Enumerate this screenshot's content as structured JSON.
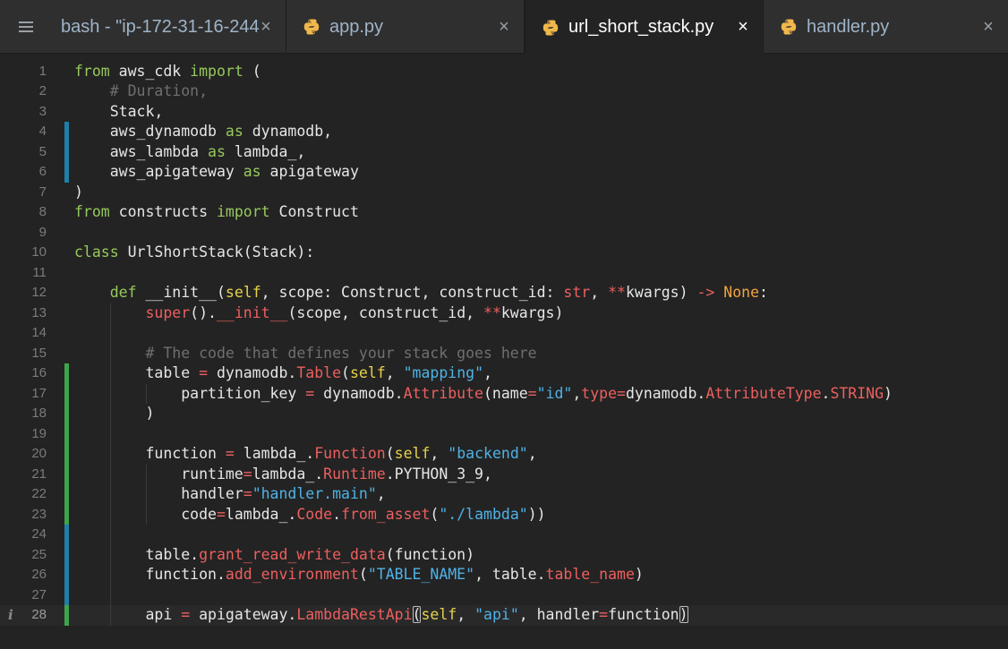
{
  "tabs": [
    {
      "label": "bash - \"ip-172-31-16-244.",
      "icon": "none",
      "close": "×"
    },
    {
      "label": "app.py",
      "icon": "python-icon",
      "close": "×"
    },
    {
      "label": "url_short_stack.py",
      "icon": "python-icon",
      "close": "×",
      "active": true
    },
    {
      "label": "handler.py",
      "icon": "python-icon",
      "close": "×"
    }
  ],
  "menu_icon": "menu-icon",
  "colors": {
    "keyword": "#97c95c",
    "comment": "#6f6f6f",
    "string": "#4fb2e6",
    "function": "#ee5f5f",
    "constant": "#f2a340",
    "self": "#e8d24b",
    "git_added": "#3fa34d",
    "git_modified": "#1f7fa8"
  },
  "editor": {
    "current_line": 28,
    "info_marker": "i",
    "lines": [
      {
        "n": "1",
        "tokens": [
          [
            "k",
            "from"
          ],
          [
            "t",
            " aws_cdk "
          ],
          [
            "k",
            "import"
          ],
          [
            "t",
            " ("
          ]
        ]
      },
      {
        "n": "2",
        "tokens": [
          [
            "t",
            "    "
          ],
          [
            "c",
            "# Duration,"
          ]
        ]
      },
      {
        "n": "3",
        "tokens": [
          [
            "t",
            "    Stack,"
          ]
        ]
      },
      {
        "n": "4",
        "tokens": [
          [
            "t",
            "    aws_dynamodb "
          ],
          [
            "k",
            "as"
          ],
          [
            "t",
            " dynamodb,"
          ]
        ]
      },
      {
        "n": "5",
        "tokens": [
          [
            "t",
            "    aws_lambda "
          ],
          [
            "k",
            "as"
          ],
          [
            "t",
            " lambda_,"
          ]
        ]
      },
      {
        "n": "6",
        "tokens": [
          [
            "t",
            "    aws_apigateway "
          ],
          [
            "k",
            "as"
          ],
          [
            "t",
            " apigateway"
          ]
        ]
      },
      {
        "n": "7",
        "tokens": [
          [
            "t",
            ")"
          ]
        ]
      },
      {
        "n": "8",
        "tokens": [
          [
            "k",
            "from"
          ],
          [
            "t",
            " constructs "
          ],
          [
            "k",
            "import"
          ],
          [
            "t",
            " Construct"
          ]
        ]
      },
      {
        "n": "9",
        "tokens": []
      },
      {
        "n": "10",
        "tokens": [
          [
            "k",
            "class"
          ],
          [
            "t",
            " UrlShortStack(Stack):"
          ]
        ]
      },
      {
        "n": "11",
        "tokens": []
      },
      {
        "n": "12",
        "tokens": [
          [
            "t",
            "    "
          ],
          [
            "k",
            "def"
          ],
          [
            "t",
            " __init__("
          ],
          [
            "y",
            "self"
          ],
          [
            "t",
            ", scope: Construct, construct_id: "
          ],
          [
            "f",
            "str"
          ],
          [
            "t",
            ", "
          ],
          [
            "f",
            "**"
          ],
          [
            "t",
            "kwargs) "
          ],
          [
            "f",
            "->"
          ],
          [
            "t",
            " "
          ],
          [
            "o",
            "None"
          ],
          [
            "t",
            ":"
          ]
        ]
      },
      {
        "n": "13",
        "tokens": [
          [
            "t",
            "        "
          ],
          [
            "f",
            "super"
          ],
          [
            "t",
            "()."
          ],
          [
            "f",
            "__init__"
          ],
          [
            "t",
            "(scope, construct_id, "
          ],
          [
            "f",
            "**"
          ],
          [
            "t",
            "kwargs)"
          ]
        ]
      },
      {
        "n": "14",
        "tokens": []
      },
      {
        "n": "15",
        "tokens": [
          [
            "t",
            "        "
          ],
          [
            "c",
            "# The code that defines your stack goes here"
          ]
        ]
      },
      {
        "n": "16",
        "tokens": [
          [
            "t",
            "        table "
          ],
          [
            "f",
            "="
          ],
          [
            "t",
            " dynamodb."
          ],
          [
            "f",
            "Table"
          ],
          [
            "t",
            "("
          ],
          [
            "y",
            "self"
          ],
          [
            "t",
            ", "
          ],
          [
            "s",
            "\"mapping\""
          ],
          [
            "t",
            ","
          ]
        ]
      },
      {
        "n": "17",
        "tokens": [
          [
            "t",
            "            partition_key "
          ],
          [
            "f",
            "="
          ],
          [
            "t",
            " dynamodb."
          ],
          [
            "f",
            "Attribute"
          ],
          [
            "t",
            "(name"
          ],
          [
            "f",
            "="
          ],
          [
            "s",
            "\"id\""
          ],
          [
            "t",
            ","
          ],
          [
            "f",
            "type"
          ],
          [
            "f",
            "="
          ],
          [
            "t",
            "dynamodb."
          ],
          [
            "f",
            "AttributeType"
          ],
          [
            "t",
            "."
          ],
          [
            "f",
            "STRING"
          ],
          [
            "t",
            ")"
          ]
        ]
      },
      {
        "n": "18",
        "tokens": [
          [
            "t",
            "        )"
          ]
        ]
      },
      {
        "n": "19",
        "tokens": []
      },
      {
        "n": "20",
        "tokens": [
          [
            "t",
            "        function "
          ],
          [
            "f",
            "="
          ],
          [
            "t",
            " lambda_."
          ],
          [
            "f",
            "Function"
          ],
          [
            "t",
            "("
          ],
          [
            "y",
            "self"
          ],
          [
            "t",
            ", "
          ],
          [
            "s",
            "\"backend\""
          ],
          [
            "t",
            ","
          ]
        ]
      },
      {
        "n": "21",
        "tokens": [
          [
            "t",
            "            runtime"
          ],
          [
            "f",
            "="
          ],
          [
            "t",
            "lambda_."
          ],
          [
            "f",
            "Runtime"
          ],
          [
            "t",
            ".PYTHON_3_9,"
          ]
        ]
      },
      {
        "n": "22",
        "tokens": [
          [
            "t",
            "            handler"
          ],
          [
            "f",
            "="
          ],
          [
            "s",
            "\"handler.main\""
          ],
          [
            "t",
            ","
          ]
        ]
      },
      {
        "n": "23",
        "tokens": [
          [
            "t",
            "            code"
          ],
          [
            "f",
            "="
          ],
          [
            "t",
            "lambda_."
          ],
          [
            "f",
            "Code"
          ],
          [
            "t",
            "."
          ],
          [
            "f",
            "from_asset"
          ],
          [
            "t",
            "("
          ],
          [
            "s",
            "\"./lambda\""
          ],
          [
            "t",
            "))"
          ]
        ]
      },
      {
        "n": "24",
        "tokens": []
      },
      {
        "n": "25",
        "tokens": [
          [
            "t",
            "        table."
          ],
          [
            "f",
            "grant_read_write_data"
          ],
          [
            "t",
            "(function)"
          ]
        ]
      },
      {
        "n": "26",
        "tokens": [
          [
            "t",
            "        function."
          ],
          [
            "f",
            "add_environment"
          ],
          [
            "t",
            "("
          ],
          [
            "s",
            "\"TABLE_NAME\""
          ],
          [
            "t",
            ", table."
          ],
          [
            "f",
            "table_name"
          ],
          [
            "t",
            ")"
          ]
        ]
      },
      {
        "n": "27",
        "tokens": []
      },
      {
        "n": "28",
        "tokens": [
          [
            "t",
            "        api "
          ],
          [
            "f",
            "="
          ],
          [
            "t",
            " apigateway."
          ],
          [
            "f",
            "LambdaRestApi"
          ],
          [
            "b",
            "("
          ],
          [
            "y",
            "self"
          ],
          [
            "t",
            ", "
          ],
          [
            "s",
            "\"api\""
          ],
          [
            "t",
            ", handler"
          ],
          [
            "f",
            "="
          ],
          [
            "t",
            "function"
          ],
          [
            "b",
            ")"
          ]
        ]
      }
    ],
    "gutter_marks": [
      {
        "lines": [
          4,
          5,
          6
        ],
        "kind": "modified"
      },
      {
        "lines": [
          16,
          17,
          18,
          19,
          20,
          21,
          22,
          23
        ],
        "kind": "added"
      },
      {
        "lines": [
          24,
          25,
          26,
          27
        ],
        "kind": "modified"
      },
      {
        "lines": [
          28
        ],
        "kind": "added"
      }
    ]
  }
}
